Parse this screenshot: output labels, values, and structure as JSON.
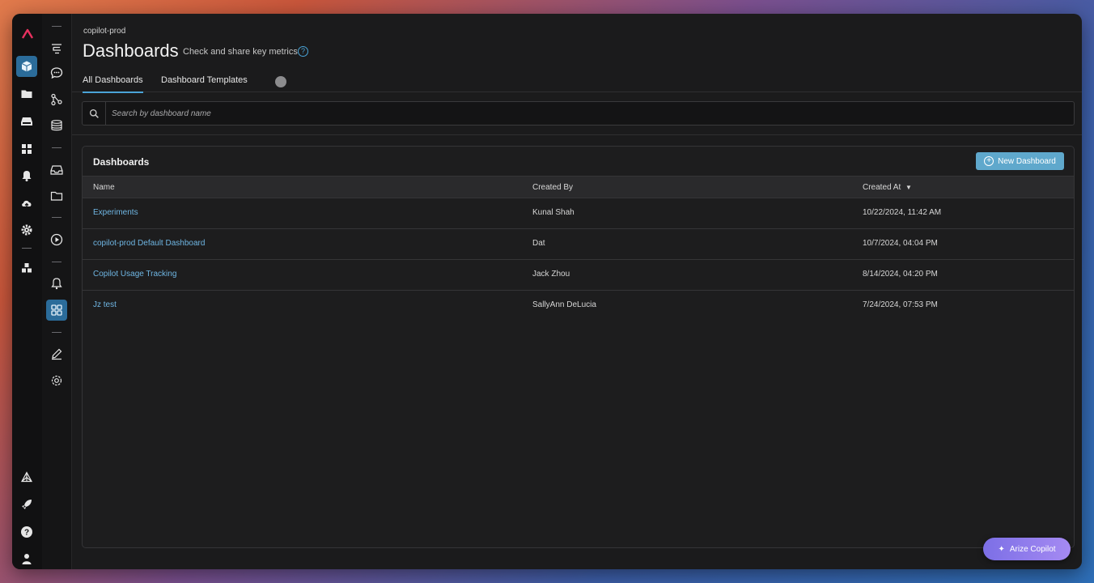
{
  "header": {
    "breadcrumb": "copilot-prod",
    "title": "Dashboards",
    "subtitle": "Check and share key metrics"
  },
  "tabs": [
    {
      "label": "All Dashboards",
      "active": true
    },
    {
      "label": "Dashboard Templates",
      "active": false
    }
  ],
  "search": {
    "placeholder": "Search by dashboard name",
    "value": ""
  },
  "panel": {
    "title": "Dashboards",
    "new_button": "New Dashboard",
    "columns": [
      "Name",
      "Created By",
      "Created At"
    ],
    "sort": {
      "column": "Created At",
      "direction": "desc"
    },
    "rows": [
      {
        "name": "Experiments",
        "created_by": "Kunal Shah",
        "created_at": "10/22/2024, 11:42 AM"
      },
      {
        "name": "copilot-prod Default Dashboard",
        "created_by": "Dat",
        "created_at": "10/7/2024, 04:04 PM"
      },
      {
        "name": "Copilot Usage Tracking",
        "created_by": "Jack Zhou",
        "created_at": "8/14/2024, 04:20 PM"
      },
      {
        "name": "Jz test",
        "created_by": "SallyAnn DeLucia",
        "created_at": "7/24/2024, 07:53 PM"
      }
    ]
  },
  "copilot_button": "Arize Copilot",
  "colors": {
    "accent": "#4aa4d8",
    "link": "#6fb6e3",
    "logo": "#e8315f",
    "new_button": "#5fa8cc",
    "copilot_gradient": [
      "#7c6fe6",
      "#a58af2"
    ]
  },
  "icons": {
    "rail_primary": [
      "arize-logo-icon",
      "cube-icon",
      "folder-icon",
      "inbox-icon",
      "grid-icon",
      "bell-icon",
      "cloud-upload-icon",
      "settings-icon",
      "puzzle-icon",
      "network-icon",
      "rocket-icon",
      "help-icon",
      "user-icon"
    ],
    "rail_secondary": [
      "tracing-icon",
      "chat-icon",
      "flow-icon",
      "database-icon",
      "inbox-icon",
      "folder-icon",
      "play-icon",
      "bell-icon",
      "dashboards-icon",
      "edit-icon",
      "settings-icon"
    ]
  }
}
